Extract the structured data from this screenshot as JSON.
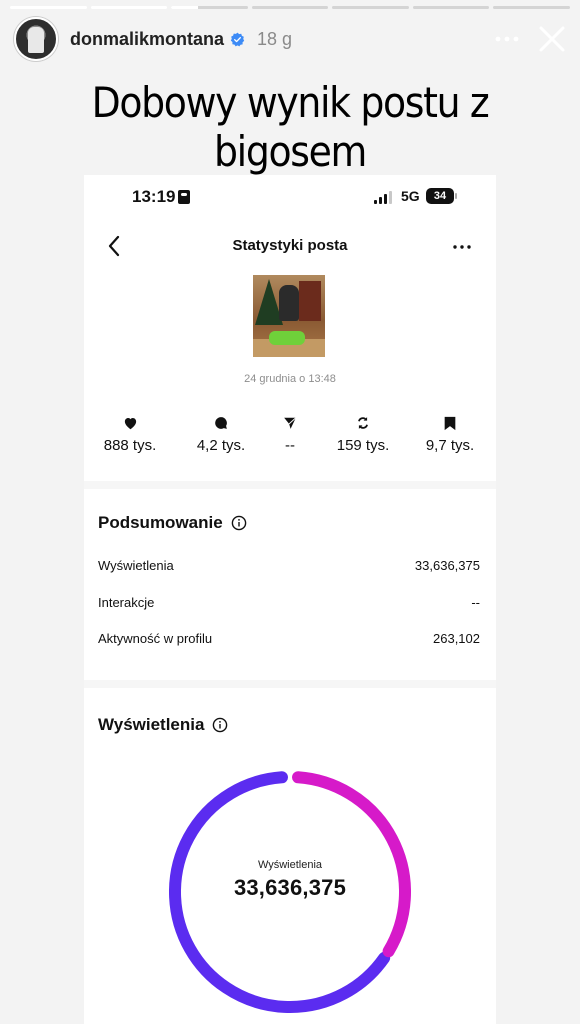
{
  "story": {
    "progress": [
      1,
      1,
      0.35,
      0,
      0,
      0,
      0
    ],
    "username": "donmalikmontana",
    "time": "18 g",
    "caption": "Dobowy wynik postu z bigosem",
    "icons": {
      "more": "more-horizontal-icon",
      "close": "close-icon",
      "verified": "verified-badge-icon"
    }
  },
  "screenshot": {
    "status_bar": {
      "time": "13:19",
      "network": "5G",
      "battery": "34"
    },
    "nav": {
      "title": "Statystyki posta"
    },
    "post": {
      "date": "24 grudnia o 13:48"
    },
    "metrics": [
      {
        "icon": "heart-icon",
        "value": "888 tys."
      },
      {
        "icon": "comment-icon",
        "value": "4,2 tys."
      },
      {
        "icon": "share-icon",
        "value": "--"
      },
      {
        "icon": "repost-icon",
        "value": "159 tys."
      },
      {
        "icon": "save-icon",
        "value": "9,7 tys."
      }
    ],
    "summary": {
      "title": "Podsumowanie",
      "rows": [
        {
          "label": "Wyświetlenia",
          "value": "33,636,375"
        },
        {
          "label": "Interakcje",
          "value": "--"
        },
        {
          "label": "Aktywność w profilu",
          "value": "263,102"
        }
      ]
    },
    "views": {
      "title": "Wyświetlenia",
      "center_label": "Wyświetlenia",
      "center_value": "33,636,375"
    },
    "colors": {
      "donut_start": "#5b2cf0",
      "donut_end": "#d61ac9"
    }
  }
}
